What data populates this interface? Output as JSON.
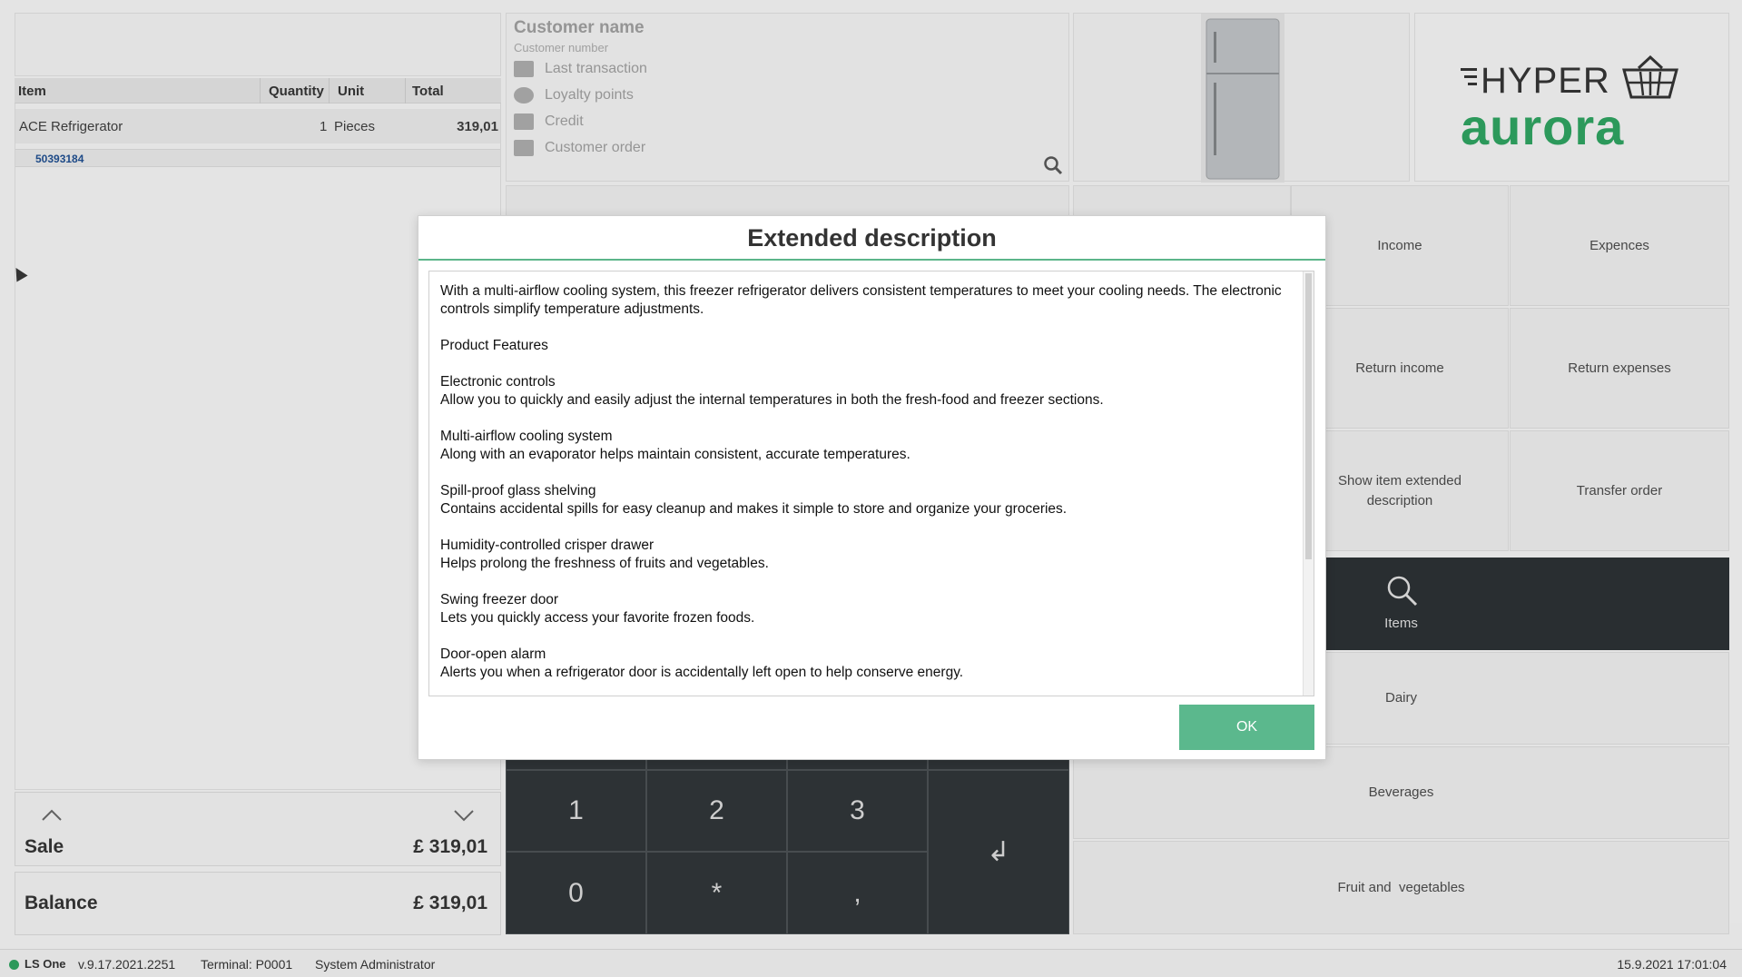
{
  "grid": {
    "headers": {
      "item": "Item",
      "quantity": "Quantity",
      "unit": "Unit",
      "total": "Total"
    },
    "rows": [
      {
        "item": "ACE Refrigerator",
        "quantity": "1",
        "unit": "Pieces",
        "total": "319,01",
        "code": "50393184"
      }
    ]
  },
  "totals": {
    "sale_label": "Sale",
    "sale_value": "£ 319,01",
    "balance_label": "Balance",
    "balance_value": "£ 319,01"
  },
  "customer": {
    "name": "Customer name",
    "number": "Customer number",
    "lines": [
      "Last transaction",
      "Loyalty points",
      "Credit",
      "Customer order"
    ]
  },
  "logo": {
    "line1": "HYPER",
    "line2": "aurora"
  },
  "buttons": {
    "income": "Income",
    "expences": "Expences",
    "return_income": "Return income",
    "return_expenses": "Return expenses",
    "show_item_extended": "Show item extended description",
    "transfer_order": "Transfer order",
    "items": "Items",
    "dairy": "Dairy",
    "beverages": "Beverages",
    "fruit_veg": "Fruit and  vegetables"
  },
  "keypad": {
    "k1": "1",
    "k2": "2",
    "k3": "3",
    "k0": "0",
    "kstar": "*",
    "kcomma": ",",
    "enter": "↲"
  },
  "status": {
    "brand": "LS One",
    "version": "v.9.17.2021.2251",
    "terminal": "Terminal: P0001",
    "user": "System Administrator",
    "datetime": "15.9.2021 17:01:04"
  },
  "dialog": {
    "title": "Extended description",
    "text": "With a multi-airflow cooling system, this freezer refrigerator delivers consistent temperatures to meet your cooling needs. The electronic controls simplify temperature adjustments.\n\nProduct Features\n\nElectronic controls\nAllow you to quickly and easily adjust the internal temperatures in both the fresh-food and freezer sections.\n\nMulti-airflow cooling system\nAlong with an evaporator helps maintain consistent, accurate temperatures.\n\nSpill-proof glass shelving\nContains accidental spills for easy cleanup and makes it simple to store and organize your groceries.\n\nHumidity-controlled crisper drawer\nHelps prolong the freshness of fruits and vegetables.\n\nSwing freezer door\nLets you quickly access your favorite frozen foods.\n\nDoor-open alarm\nAlerts you when a refrigerator door is accidentally left open to help conserve energy.",
    "ok": "OK"
  },
  "colors": {
    "accent": "#5bb88d",
    "dark_button": "#2b3033",
    "logo_green": "#2e9e5e"
  }
}
